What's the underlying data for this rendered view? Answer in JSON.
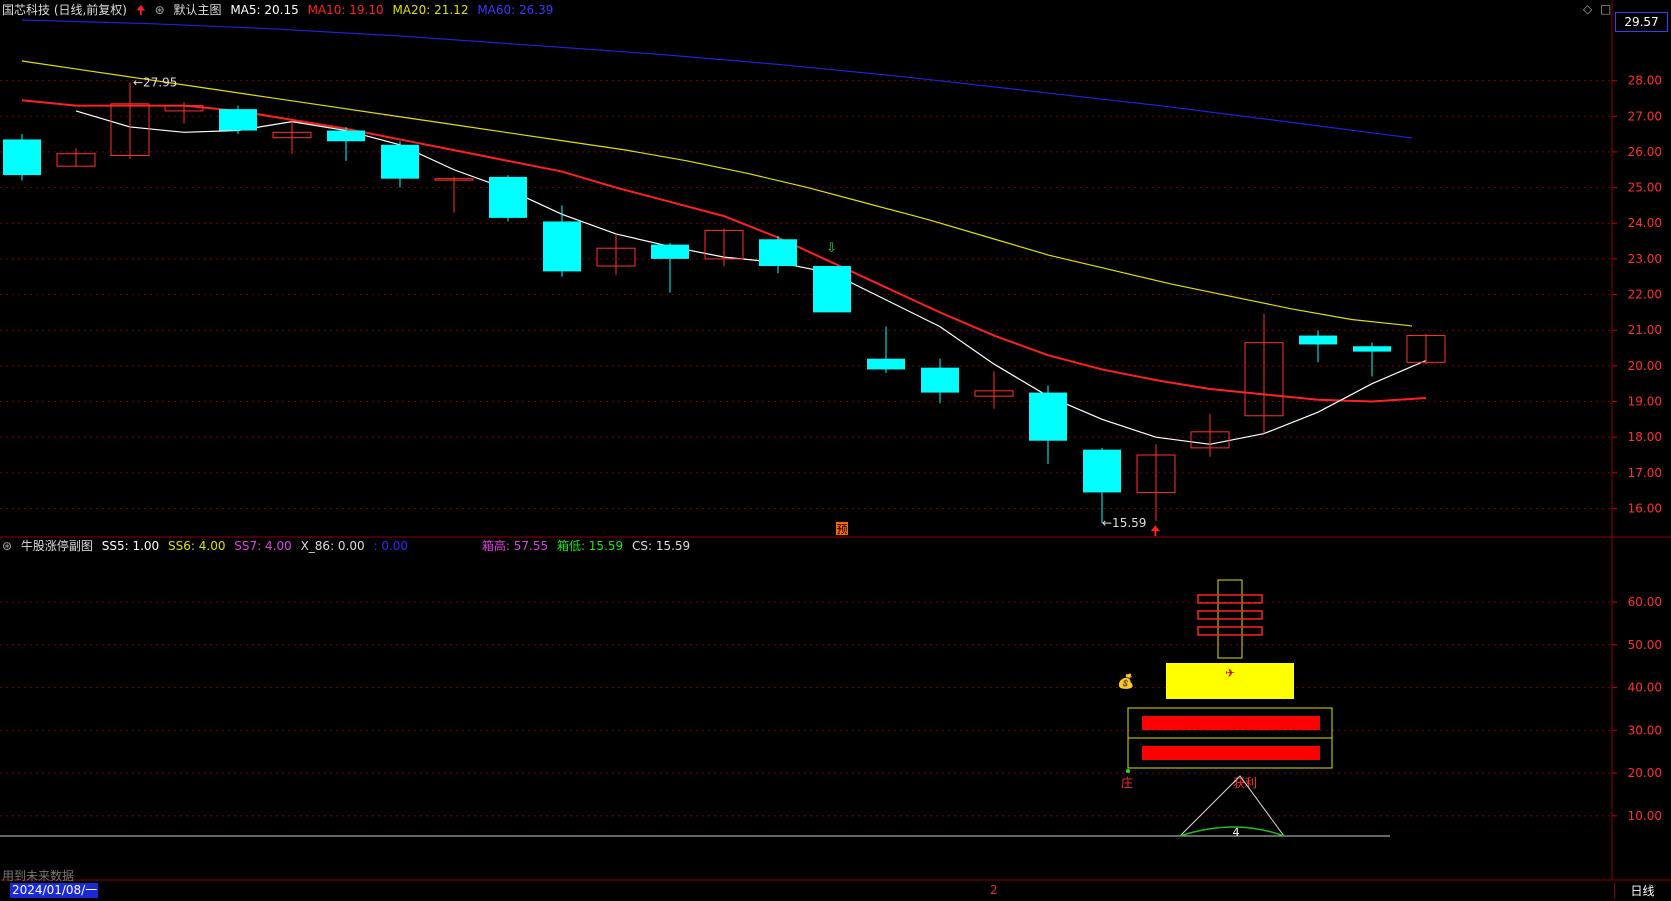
{
  "main_header": {
    "stock": "国芯科技 (日线,前复权)",
    "template": "默认主图",
    "ma5": "MA5: 20.15",
    "ma10": "MA10: 19.10",
    "ma20": "MA20: 21.12",
    "ma60": "MA60: 26.39"
  },
  "sub_header": {
    "title": "牛股涨停副图",
    "ss5": "SS5: 1.00",
    "ss6": "SS6: 4.00",
    "ss7": "SS7: 4.00",
    "x86": "X_86: 0.00",
    "blank": ": 0.00",
    "box_high": "箱高: 57.55",
    "box_low": "箱低: 15.59",
    "cs": "CS: 15.59"
  },
  "current_price_tag": "29.57",
  "high_marker": "27.95",
  "low_marker": "15.59",
  "forecast_badge": "预",
  "sub_labels": {
    "zhuang": "庄",
    "gain": "获利",
    "n4": "4"
  },
  "footer": {
    "date": "2024/01/08/一",
    "no_future": "用到未来数据",
    "page": "2",
    "period": "日线"
  },
  "price_axis": [
    "28.00",
    "27.00",
    "26.00",
    "25.00",
    "24.00",
    "23.00",
    "22.00",
    "21.00",
    "20.00",
    "19.00",
    "18.00",
    "17.00",
    "16.00"
  ],
  "sub_axis": [
    "60.00",
    "50.00",
    "40.00",
    "30.00",
    "20.00",
    "10.00"
  ],
  "colors": {
    "up": "#ff3030",
    "down": "#00ffff",
    "ma5": "#ffffff",
    "ma10": "#ff2020",
    "ma20": "#e0e000",
    "ma60": "#2020dd",
    "grid": "#7a0000"
  },
  "chart_data": {
    "type": "candlestick",
    "ylim": [
      15.2,
      29.7
    ],
    "candles": [
      {
        "o": 26.35,
        "h": 26.5,
        "l": 25.2,
        "c": 25.35
      },
      {
        "o": 25.6,
        "h": 26.1,
        "l": 25.6,
        "c": 25.95
      },
      {
        "o": 25.9,
        "h": 27.95,
        "l": 25.8,
        "c": 27.35
      },
      {
        "o": 27.15,
        "h": 27.4,
        "l": 26.8,
        "c": 27.3
      },
      {
        "o": 27.2,
        "h": 27.3,
        "l": 26.5,
        "c": 26.6
      },
      {
        "o": 26.4,
        "h": 26.9,
        "l": 25.95,
        "c": 26.55
      },
      {
        "o": 26.6,
        "h": 26.7,
        "l": 25.75,
        "c": 26.3
      },
      {
        "o": 26.2,
        "h": 26.3,
        "l": 25.0,
        "c": 25.25
      },
      {
        "o": 25.25,
        "h": 25.3,
        "l": 24.3,
        "c": 25.25
      },
      {
        "o": 25.3,
        "h": 25.35,
        "l": 24.05,
        "c": 24.15
      },
      {
        "o": 24.05,
        "h": 24.5,
        "l": 22.5,
        "c": 22.65
      },
      {
        "o": 22.8,
        "h": 23.7,
        "l": 22.55,
        "c": 23.3
      },
      {
        "o": 23.4,
        "h": 23.45,
        "l": 22.05,
        "c": 23.0
      },
      {
        "o": 23.0,
        "h": 23.85,
        "l": 22.8,
        "c": 23.8
      },
      {
        "o": 23.55,
        "h": 23.65,
        "l": 22.6,
        "c": 22.8
      },
      {
        "o": 22.8,
        "h": 22.8,
        "l": 21.5,
        "c": 21.5
      },
      {
        "o": 20.2,
        "h": 21.1,
        "l": 19.8,
        "c": 19.9
      },
      {
        "o": 19.95,
        "h": 20.2,
        "l": 18.95,
        "c": 19.25
      },
      {
        "o": 19.15,
        "h": 19.85,
        "l": 18.8,
        "c": 19.3
      },
      {
        "o": 19.25,
        "h": 19.45,
        "l": 17.25,
        "c": 17.9
      },
      {
        "o": 17.65,
        "h": 17.7,
        "l": 15.59,
        "c": 16.45
      },
      {
        "o": 16.45,
        "h": 17.8,
        "l": 15.65,
        "c": 17.5
      },
      {
        "o": 17.7,
        "h": 18.65,
        "l": 17.45,
        "c": 18.15
      },
      {
        "o": 18.6,
        "h": 21.45,
        "l": 18.1,
        "c": 20.65
      },
      {
        "o": 20.85,
        "h": 21.0,
        "l": 20.1,
        "c": 20.6
      },
      {
        "o": 20.55,
        "h": 20.65,
        "l": 19.7,
        "c": 20.4
      },
      {
        "o": 20.1,
        "h": 20.9,
        "l": 20.05,
        "c": 20.85
      }
    ],
    "ma5": [
      27.15,
      26.7,
      26.55,
      26.6,
      26.85,
      26.6,
      26.2,
      25.5,
      24.95,
      24.25,
      23.7,
      23.35,
      23.05,
      22.9,
      22.6,
      21.85,
      21.1,
      20.05,
      19.15,
      18.5,
      18.0,
      17.8,
      18.1,
      18.7,
      19.5,
      20.15
    ],
    "ma10": [
      27.45,
      27.3,
      27.3,
      27.3,
      27.15,
      26.9,
      26.65,
      26.35,
      26.05,
      25.75,
      25.45,
      25.0,
      24.6,
      24.2,
      23.6,
      22.9,
      22.2,
      21.5,
      20.85,
      20.3,
      19.9,
      19.6,
      19.35,
      19.2,
      19.05,
      19.0,
      19.1
    ],
    "ma20": [
      28.55,
      28.3,
      28.05,
      27.8,
      27.55,
      27.3,
      27.05,
      26.8,
      26.55,
      26.3,
      26.05,
      25.75,
      25.4,
      25.0,
      24.55,
      24.1,
      23.6,
      23.1,
      22.7,
      22.3,
      21.95,
      21.6,
      21.3,
      21.12
    ],
    "ma60": [
      29.7,
      29.6,
      29.45,
      29.25,
      29.0,
      28.75,
      28.45,
      28.1,
      27.7,
      27.3,
      26.85,
      26.39
    ]
  }
}
